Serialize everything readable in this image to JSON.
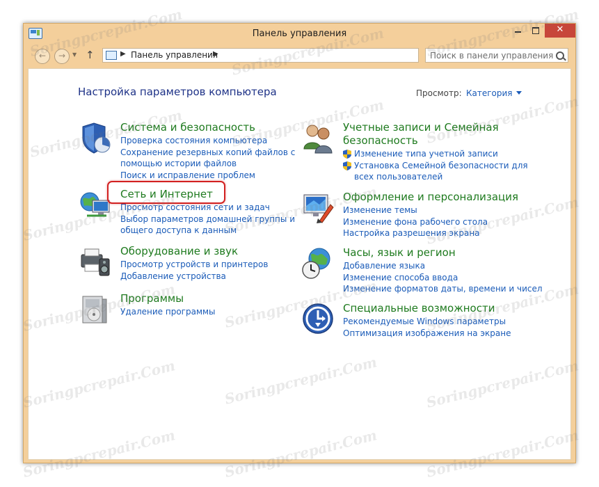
{
  "window": {
    "title": "Панель управления",
    "close_symbol": "✕"
  },
  "nav": {
    "back_icon": "←",
    "forward_icon": "→",
    "up_icon": "↑",
    "address_path": "Панель управления",
    "search_placeholder": "Поиск в панели управления"
  },
  "main": {
    "heading": "Настройка параметров компьютера",
    "view_label": "Просмотр:",
    "view_value": "Категория"
  },
  "categories": {
    "security": {
      "title": "Система и безопасность",
      "links": [
        "Проверка состояния компьютера",
        "Сохранение резервных копий файлов с",
        "помощью истории файлов",
        "Поиск и исправление проблем"
      ]
    },
    "network": {
      "title": "Сеть и Интернет",
      "links": [
        "Просмотр состояния сети и задач",
        "Выбор параметров домашней группы и",
        "общего доступа к данным"
      ]
    },
    "hardware": {
      "title": "Оборудование и звук",
      "links": [
        "Просмотр устройств и принтеров",
        "Добавление устройства"
      ]
    },
    "programs": {
      "title": "Программы",
      "links": [
        "Удаление программы"
      ]
    },
    "accounts": {
      "title_line1": "Учетные записи и Семейная",
      "title_line2": "безопасность",
      "links": [
        "Изменение типа учетной записи",
        "Установка Семейной безопасности для",
        "всех пользователей"
      ]
    },
    "appearance": {
      "title": "Оформление и персонализация",
      "links": [
        "Изменение темы",
        "Изменение фона рабочего стола",
        "Настройка разрешения экрана"
      ]
    },
    "clock": {
      "title": "Часы, язык и регион",
      "links": [
        "Добавление языка",
        "Изменение способа ввода",
        "Изменение форматов даты, времени и чисел"
      ]
    },
    "ease": {
      "title": "Специальные возможности",
      "links": [
        "Рекомендуемые Windows параметры",
        "Оптимизация изображения на экране"
      ]
    }
  },
  "watermark": "Soringpcrepair.Com",
  "colors": {
    "frame": "#f4cf9b",
    "close": "#c7463a",
    "link": "#1a5bb8",
    "category": "#1e7a1e",
    "heading": "#1e3287",
    "highlight": "#d22020"
  }
}
